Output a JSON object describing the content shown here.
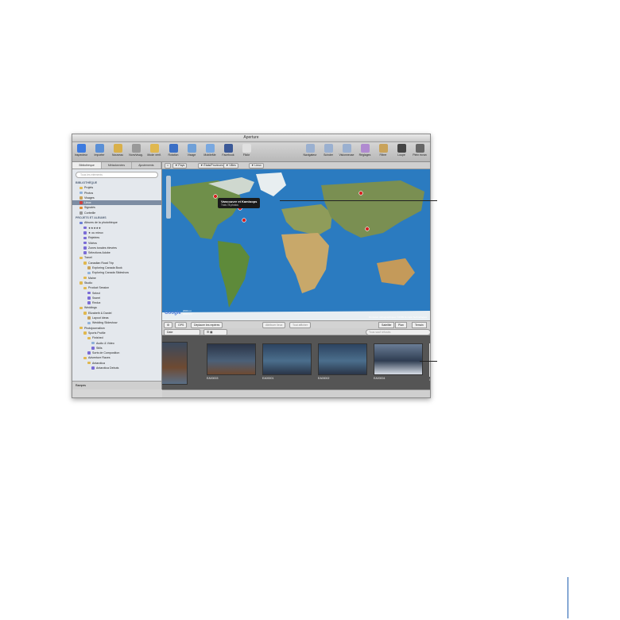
{
  "window": {
    "title": "Aperture"
  },
  "toolbar": {
    "left": [
      {
        "label": "Inspecteur",
        "icon": "info-icon",
        "color": "#3d7be0"
      },
      {
        "label": "Importer",
        "icon": "import-icon",
        "color": "#5a8fd6"
      },
      {
        "label": "Nouveau",
        "icon": "new-project-icon",
        "color": "#d9b04a"
      },
      {
        "label": "Nom/visag.",
        "icon": "faces-icon",
        "color": "#999999"
      },
      {
        "label": "Mode vérif.",
        "icon": "review-icon",
        "color": "#e0b850"
      }
    ],
    "center": [
      {
        "label": "Rotation",
        "icon": "pointer-icon",
        "color": "#3a6fc6"
      },
      {
        "label": "Visage",
        "icon": "map-icon",
        "color": "#6fa0d8"
      },
      {
        "label": "MobileMe",
        "icon": "cloud-icon",
        "color": "#79a8e0"
      },
      {
        "label": "Facebook",
        "icon": "facebook-icon",
        "color": "#3b5998"
      },
      {
        "label": "Flickr",
        "icon": "flickr-icon",
        "color": "#e0e0e0"
      }
    ],
    "right": [
      {
        "label": "Navigateur",
        "icon": "browser-icon",
        "color": "#9ab0d0"
      },
      {
        "label": "Scinder",
        "icon": "split-icon",
        "color": "#9ab0d0"
      },
      {
        "label": "Visionneuse",
        "icon": "viewer-icon",
        "color": "#9ab0d0"
      },
      {
        "label": "Réglages",
        "icon": "adjust-icon",
        "color": "#b08ad0"
      },
      {
        "label": "Filtrer",
        "icon": "filter-icon",
        "color": "#c9a35a"
      },
      {
        "label": "Loupe",
        "icon": "loupe-icon",
        "color": "#444444"
      },
      {
        "label": "Plein écran",
        "icon": "fullscreen-icon",
        "color": "#666666"
      }
    ]
  },
  "sidebar": {
    "tabs": [
      "Bibliothèque",
      "Métadonnées",
      "Ajustements"
    ],
    "search_placeholder": "Tous les éléments",
    "rows": [
      {
        "label": "BIBLIOTHÈQUE",
        "type": "section",
        "indent": 0
      },
      {
        "label": "Projets",
        "indent": 1,
        "color": "#e0b850"
      },
      {
        "label": "Photos",
        "indent": 1,
        "color": "#8fb0d8"
      },
      {
        "label": "Visages",
        "indent": 1,
        "color": "#c9a35a"
      },
      {
        "label": "Lieux",
        "indent": 1,
        "color": "#d04040",
        "selected": true
      },
      {
        "label": "Signalés",
        "indent": 1,
        "color": "#e08a30"
      },
      {
        "label": "Corbeille",
        "indent": 1,
        "color": "#999999"
      },
      {
        "label": "PROJETS ET ALBUMS",
        "type": "section",
        "indent": 0
      },
      {
        "label": "Albums de la photothèque",
        "indent": 1,
        "color": "#6c7fd6"
      },
      {
        "label": "★★★★★",
        "indent": 2,
        "color": "#7a6cd6"
      },
      {
        "label": "★ ou mieux",
        "indent": 2,
        "color": "#7a6cd6"
      },
      {
        "label": "Rejetées",
        "indent": 2,
        "color": "#7a6cd6"
      },
      {
        "label": "Vidéos",
        "indent": 2,
        "color": "#7a6cd6"
      },
      {
        "label": "Zones tonales élevées",
        "indent": 2,
        "color": "#7a6cd6"
      },
      {
        "label": "Sélections Adobe",
        "indent": 2,
        "color": "#7a6cd6"
      },
      {
        "label": "Travel",
        "indent": 1,
        "color": "#e0b850"
      },
      {
        "label": "Canadian Road Trip",
        "indent": 2,
        "color": "#e0b850"
      },
      {
        "label": "Exploring Canada Book",
        "indent": 3,
        "color": "#c9a35a"
      },
      {
        "label": "Exploring Canada Slideshow",
        "indent": 3,
        "color": "#8fb0d8"
      },
      {
        "label": "Maine",
        "indent": 2,
        "color": "#e0b850"
      },
      {
        "label": "Studio",
        "indent": 1,
        "color": "#e0b850"
      },
      {
        "label": "Product Session",
        "indent": 2,
        "color": "#e0b850"
      },
      {
        "label": "Select",
        "indent": 3,
        "color": "#7a6cd6"
      },
      {
        "label": "Sweet",
        "indent": 3,
        "color": "#7a6cd6"
      },
      {
        "label": "Redux",
        "indent": 3,
        "color": "#7a6cd6"
      },
      {
        "label": "Weddings",
        "indent": 1,
        "color": "#e0b850"
      },
      {
        "label": "Elizabeth & Daniel",
        "indent": 2,
        "color": "#e0b850"
      },
      {
        "label": "Layout Ideas",
        "indent": 3,
        "color": "#c9a35a"
      },
      {
        "label": "Wedding Slideshow",
        "indent": 3,
        "color": "#8fb0d8"
      },
      {
        "label": "Photojournalism",
        "indent": 1,
        "color": "#e0b850"
      },
      {
        "label": "Sports Profile",
        "indent": 2,
        "color": "#e0b850"
      },
      {
        "label": "Finished",
        "indent": 3,
        "color": "#e0b850"
      },
      {
        "label": "Audio & Video",
        "indent": 4,
        "color": "#8fb0d8"
      },
      {
        "label": "Stills",
        "indent": 4,
        "color": "#7a6cd6"
      },
      {
        "label": "Sorts de Composition",
        "indent": 3,
        "color": "#7a6cd6"
      },
      {
        "label": "Adventure Races",
        "indent": 2,
        "color": "#e0b850"
      },
      {
        "label": "Antarctica",
        "indent": 3,
        "color": "#e0b850"
      },
      {
        "label": "Antarctica Debuts",
        "indent": 4,
        "color": "#7a6cd6"
      }
    ],
    "footer_label": "Rampes"
  },
  "mapbar": {
    "crumbs": [
      "▼ Pays",
      "▼ États/Provinces",
      "▼ Villes",
      "▼ Lieux"
    ]
  },
  "map": {
    "popup_title": "Vancouver et Kamloops",
    "popup_subtitle": "Trois 78 photos",
    "logo": "Google",
    "scale_top": "2000 mi",
    "scale_bottom": "2000 km",
    "attribution": "Données cartographiques ©2009 Europa Technologies",
    "pins_color": "#d62020"
  },
  "maptool": {
    "gps_label": "GPS",
    "move_label": "Déplacer les repères",
    "center_a": "Attribuer lieux",
    "center_b": "Tout afficher",
    "right_buttons": [
      "Satellite",
      "Plan",
      "Terrain"
    ]
  },
  "sortbar": {
    "sort_value": "Date",
    "search_placeholder": "Tous sauf refusés",
    "view_icons": "list-grid-icons"
  },
  "browser": {
    "thumbs": [
      {
        "caption": "EA00003",
        "colors": [
          "#2a3548",
          "#4b6078",
          "#6e4a32"
        ]
      },
      {
        "caption": "EA00001",
        "colors": [
          "#2c4360",
          "#4b6e8c",
          "#2a3548"
        ]
      },
      {
        "caption": "EA00002",
        "colors": [
          "#2c4360",
          "#4b6e8c",
          "#2a3548"
        ]
      },
      {
        "caption": "EA00004",
        "colors": [
          "#6a7d96",
          "#2f3d52",
          "#d7dde6"
        ]
      },
      {
        "caption": "Canada 097",
        "colors": [
          "#3e566e",
          "#97a9bc",
          "#d9dee5"
        ],
        "selected": true
      }
    ]
  },
  "statusbar": {
    "text": ""
  }
}
